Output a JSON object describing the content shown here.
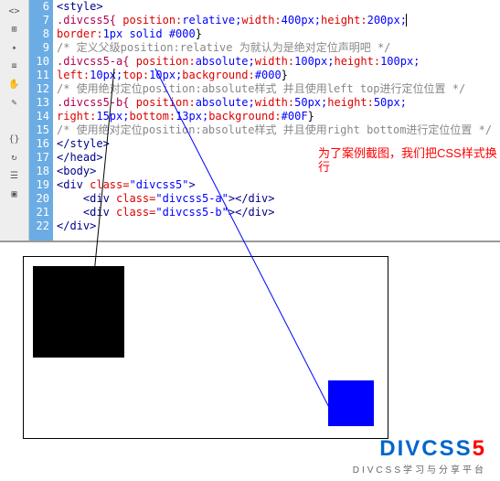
{
  "gutter": [
    "6",
    "7",
    "8",
    "9",
    "10",
    "11",
    "12",
    "13",
    "14",
    "15",
    "16",
    "17",
    "18",
    "19",
    "20",
    "21",
    "22"
  ],
  "code": {
    "l6": {
      "tag": "<style>"
    },
    "l7": {
      "sel": ".divcss5{",
      "prop": " position:",
      "val1": "relative;",
      "prop2": "width:",
      "val2": "400px;",
      "prop3": "height:",
      "val3": "200px;"
    },
    "l8": {
      "prop": "border:",
      "val": "1px solid #000",
      "txt": "}"
    },
    "l9": {
      "cmt": "/* 定义父级position:relative 为就认为是绝对定位声明吧 */"
    },
    "l10": {
      "sel": ".divcss5-a{",
      "prop": " position:",
      "val1": "absolute;",
      "prop2": "width:",
      "val2": "100px;",
      "prop3": "height:",
      "val3": "100px;"
    },
    "l11": {
      "prop": "left:",
      "val1": "10px;",
      "prop2": "top:",
      "val2": "10px;",
      "prop3": "background:",
      "val3": "#000",
      "txt": "}"
    },
    "l12": {
      "cmt": "/* 使用绝对定位position:absolute样式 并且使用left top进行定位位置 */"
    },
    "l13": {
      "sel": ".divcss5-b{",
      "prop": " position:",
      "val1": "absolute;",
      "prop2": "width:",
      "val2": "50px;",
      "prop3": "height:",
      "val3": "50px;"
    },
    "l14": {
      "prop": "right:",
      "val1": "15px;",
      "prop2": "bottom:",
      "val2": "13px;",
      "prop3": "background:",
      "val3": "#00F",
      "txt": "}"
    },
    "l15": {
      "cmt": "/* 使用绝对定位position:absolute样式 并且使用right bottom进行定位位置 */"
    },
    "l16": {
      "tag": "</style>"
    },
    "l17": {
      "tag": "</head>"
    },
    "l18": {
      "tag": "<body>"
    },
    "l19": {
      "tag1": "<div ",
      "attr": "class=",
      "str": "\"divcss5\"",
      "tag2": ">"
    },
    "l20": {
      "tag1": "    <div ",
      "attr": "class=",
      "str": "\"divcss5-a\"",
      "tag2": "></div>"
    },
    "l21": {
      "tag1": "    <div ",
      "attr": "class=",
      "str": "\"divcss5-b\"",
      "tag2": "></div>"
    },
    "l22": {
      "tag": "</div>"
    }
  },
  "annotation": "为了案例截图，我们把CSS样式换行",
  "logo": {
    "main": "DIVCSS",
    "five": "5",
    "sub": "DIVCSS学习与分享平台"
  }
}
